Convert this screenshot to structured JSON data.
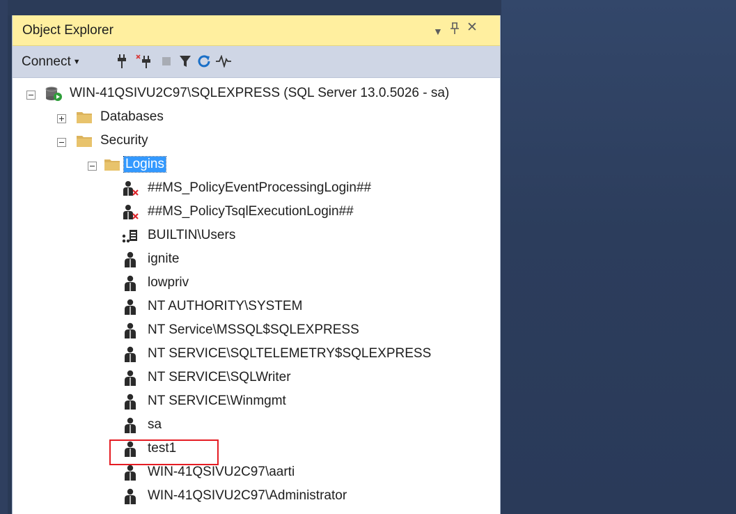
{
  "panel": {
    "title": "Object Explorer",
    "title_controls": [
      {
        "name": "dropdown-arrow-icon",
        "glyph": "▾"
      },
      {
        "name": "pin-icon",
        "glyph": "⊥"
      },
      {
        "name": "close-icon",
        "glyph": "✕"
      }
    ]
  },
  "toolbar": {
    "connect_label": "Connect",
    "icons": [
      "connect-plug-icon",
      "disconnect-plug-icon",
      "stop-icon",
      "filter-icon",
      "refresh-icon",
      "activity-monitor-icon"
    ]
  },
  "tree": {
    "server": {
      "label": "WIN-41QSIVU2C97\\SQLEXPRESS (SQL Server 13.0.5026 - sa)",
      "expanded": true
    },
    "nodes": [
      {
        "label": "Databases",
        "expanded": false
      },
      {
        "label": "Security",
        "expanded": true
      },
      {
        "label": "Logins",
        "expanded": true,
        "selected": true
      }
    ],
    "logins": [
      {
        "label": "##MS_PolicyEventProcessingLogin##",
        "icon": "disabled-login-icon"
      },
      {
        "label": "##MS_PolicyTsqlExecutionLogin##",
        "icon": "disabled-login-icon"
      },
      {
        "label": "BUILTIN\\Users",
        "icon": "group-login-icon"
      },
      {
        "label": "ignite",
        "icon": "user-login-icon"
      },
      {
        "label": "lowpriv",
        "icon": "user-login-icon"
      },
      {
        "label": "NT AUTHORITY\\SYSTEM",
        "icon": "user-login-icon"
      },
      {
        "label": "NT Service\\MSSQL$SQLEXPRESS",
        "icon": "user-login-icon"
      },
      {
        "label": "NT SERVICE\\SQLTELEMETRY$SQLEXPRESS",
        "icon": "user-login-icon"
      },
      {
        "label": "NT SERVICE\\SQLWriter",
        "icon": "user-login-icon"
      },
      {
        "label": "NT SERVICE\\Winmgmt",
        "icon": "user-login-icon"
      },
      {
        "label": "sa",
        "icon": "user-login-icon"
      },
      {
        "label": "test1",
        "icon": "user-login-icon",
        "highlighted": true
      },
      {
        "label": "WIN-41QSIVU2C97\\aarti",
        "icon": "user-login-icon"
      },
      {
        "label": "WIN-41QSIVU2C97\\Administrator",
        "icon": "user-login-icon"
      }
    ]
  },
  "colors": {
    "title_bar": "#ffef9f",
    "toolbar": "#cfd6e5",
    "selection": "#3399ff",
    "highlight_box": "#e51c23",
    "background": "#293955"
  }
}
